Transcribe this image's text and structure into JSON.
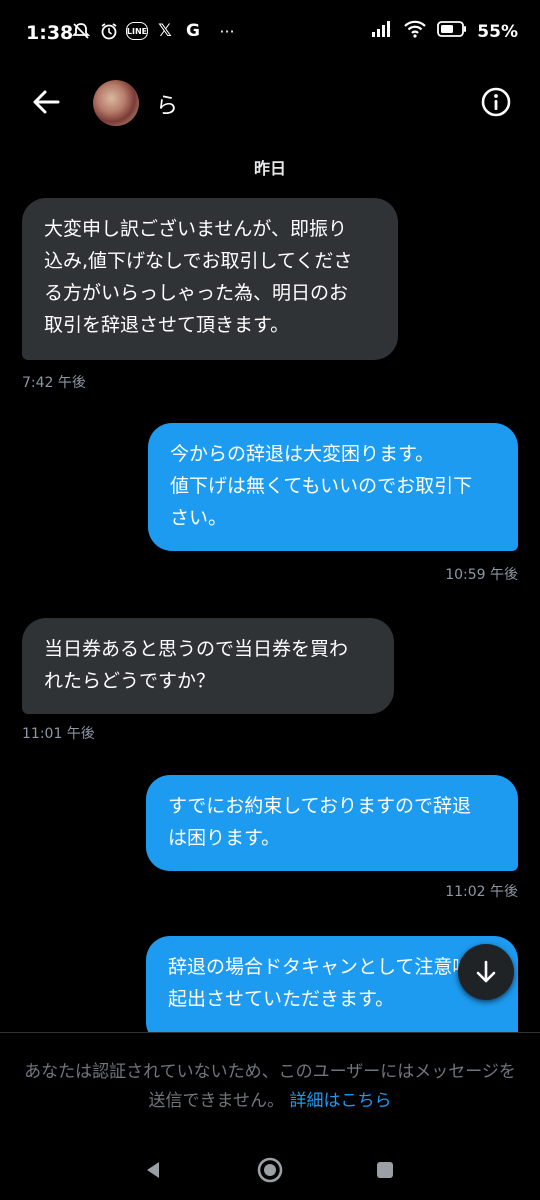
{
  "status_bar": {
    "time": "1:38",
    "icons": [
      "muted-notification-icon",
      "alarm-icon",
      "line-app-icon",
      "x-app-icon",
      "google-icon",
      "more-dots-icon"
    ],
    "line_label": "LINE",
    "x_label": "𝕏",
    "g_label": "G",
    "dots_label": "···",
    "battery_percent": "55%"
  },
  "header": {
    "username": "ら"
  },
  "conversation": {
    "date_separator": "昨日",
    "messages": [
      {
        "direction": "incoming",
        "text": "大変申し訳ございませんが、即振り\n込み,値下げなしでお取引してくださ\nる方がいらっしゃった為、明日のお\n取引を辞退させて頂きます。",
        "time": "7:42 午後"
      },
      {
        "direction": "outgoing",
        "text": "今からの辞退は大変困ります。\n値下げは無くてもいいのでお取引下\nさい。",
        "time": "10:59 午後"
      },
      {
        "direction": "incoming",
        "text": "当日券あると思うので当日券を買わ\nれたらどうですか？",
        "time": "11:01 午後"
      },
      {
        "direction": "outgoing",
        "text": "すでにお約束しておりますので辞退\nは困ります。",
        "time": "11:02 午後"
      },
      {
        "direction": "outgoing",
        "text": "辞退の場合ドタキャンとして注意喚\n起出させていただきます。",
        "time": ""
      }
    ]
  },
  "footer": {
    "notice": "あなたは認証されていないため、このユーザーにはメッセージを送信できません。",
    "link": "詳細はこちら"
  },
  "colors": {
    "background": "#000000",
    "incoming_bubble": "#2f3336",
    "outgoing_bubble": "#1d9bf0",
    "link": "#1d9bf0",
    "muted_text": "#71767b"
  }
}
